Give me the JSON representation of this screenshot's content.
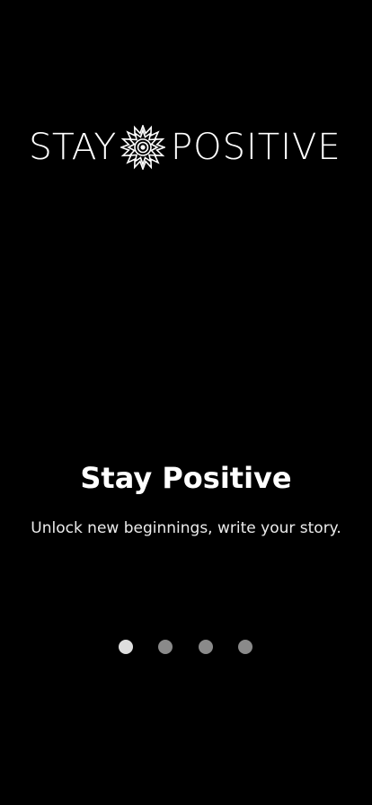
{
  "logo": {
    "left_word": "STAY",
    "right_word": "POSITIVE",
    "mark_icon": "mandala-icon"
  },
  "onboarding": {
    "title": "Stay Positive",
    "subtitle": "Unlock new beginnings, write your story."
  },
  "pager": {
    "current_page": 1,
    "total_pages": 4
  },
  "colors": {
    "background": "#000000",
    "text": "#ffffff",
    "dot_active": "#dedede",
    "dot_inactive": "#8a8a8a"
  }
}
